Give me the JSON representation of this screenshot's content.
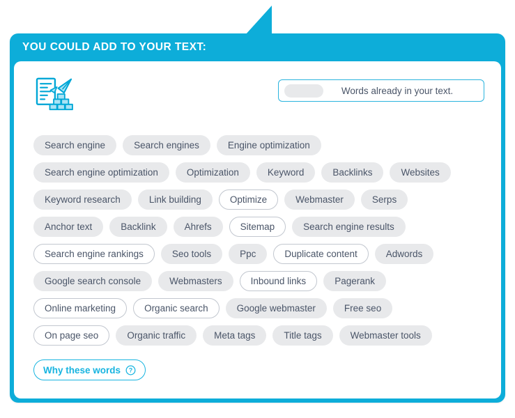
{
  "header": {
    "title": "YOU COULD ADD TO YOUR TEXT:"
  },
  "colors": {
    "accent": "#0dadd9",
    "accent_border": "#17b4e0",
    "tag_fill": "#e8e9eb",
    "tag_text": "#4a5568",
    "tag_outline": "#c2c7cf",
    "panel": "#ffffff"
  },
  "icons": {
    "document_rocket": "document-blocks-icon",
    "question": "question-circle-icon"
  },
  "legend": {
    "label": "Words already in your text."
  },
  "footer": {
    "why_label": "Why these words"
  },
  "tag_rows": [
    [
      {
        "label": "Search engine",
        "style": "filled"
      },
      {
        "label": "Search engines",
        "style": "filled"
      },
      {
        "label": "Engine optimization",
        "style": "filled"
      }
    ],
    [
      {
        "label": "Search engine optimization",
        "style": "filled"
      },
      {
        "label": "Optimization",
        "style": "filled"
      },
      {
        "label": "Keyword",
        "style": "filled"
      },
      {
        "label": "Backlinks",
        "style": "filled"
      },
      {
        "label": "Websites",
        "style": "filled"
      }
    ],
    [
      {
        "label": "Keyword research",
        "style": "filled"
      },
      {
        "label": "Link building",
        "style": "filled"
      },
      {
        "label": "Optimize",
        "style": "outlined"
      },
      {
        "label": "Webmaster",
        "style": "filled"
      },
      {
        "label": "Serps",
        "style": "filled"
      }
    ],
    [
      {
        "label": "Anchor text",
        "style": "filled"
      },
      {
        "label": "Backlink",
        "style": "filled"
      },
      {
        "label": "Ahrefs",
        "style": "filled"
      },
      {
        "label": "Sitemap",
        "style": "outlined"
      },
      {
        "label": "Search engine results",
        "style": "filled"
      }
    ],
    [
      {
        "label": "Search engine rankings",
        "style": "outlined"
      },
      {
        "label": "Seo tools",
        "style": "filled"
      },
      {
        "label": "Ppc",
        "style": "filled"
      },
      {
        "label": "Duplicate content",
        "style": "outlined"
      },
      {
        "label": "Adwords",
        "style": "filled"
      }
    ],
    [
      {
        "label": "Google search console",
        "style": "filled"
      },
      {
        "label": "Webmasters",
        "style": "filled"
      },
      {
        "label": "Inbound links",
        "style": "outlined"
      },
      {
        "label": "Pagerank",
        "style": "filled"
      }
    ],
    [
      {
        "label": "Online marketing",
        "style": "outlined"
      },
      {
        "label": "Organic search",
        "style": "outlined"
      },
      {
        "label": "Google webmaster",
        "style": "filled"
      },
      {
        "label": "Free seo",
        "style": "filled"
      }
    ],
    [
      {
        "label": "On page seo",
        "style": "outlined"
      },
      {
        "label": "Organic traffic",
        "style": "filled"
      },
      {
        "label": "Meta tags",
        "style": "filled"
      },
      {
        "label": "Title tags",
        "style": "filled"
      },
      {
        "label": "Webmaster tools",
        "style": "filled"
      }
    ]
  ]
}
